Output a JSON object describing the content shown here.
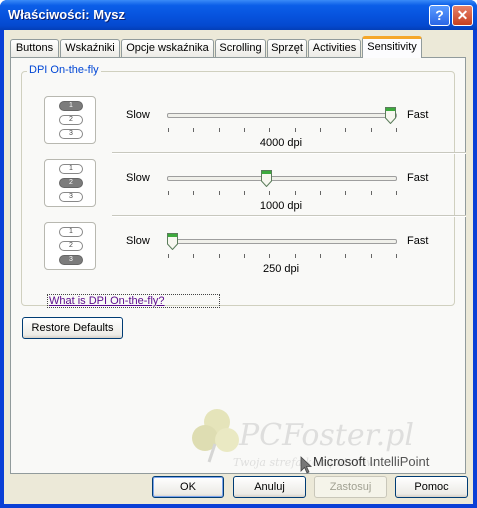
{
  "window": {
    "title": "Właściwości: Mysz"
  },
  "tabs": [
    {
      "label": "Buttons"
    },
    {
      "label": "Wskaźniki"
    },
    {
      "label": "Opcje wskaźnika"
    },
    {
      "label": "Scrolling"
    },
    {
      "label": "Sprzęt"
    },
    {
      "label": "Activities"
    },
    {
      "label": "Sensitivity",
      "active": true
    }
  ],
  "group": {
    "title": "DPI On-the-fly"
  },
  "sliders": [
    {
      "slow": "Slow",
      "fast": "Fast",
      "value_label": "4000 dpi",
      "level": 1.0,
      "active_preset": "1"
    },
    {
      "slow": "Slow",
      "fast": "Fast",
      "value_label": "1000 dpi",
      "level": 0.43,
      "active_preset": "2"
    },
    {
      "slow": "Slow",
      "fast": "Fast",
      "value_label": "250 dpi",
      "level": 0.0,
      "active_preset": "3"
    }
  ],
  "presets": [
    "1",
    "2",
    "3"
  ],
  "link": {
    "text": "What is DPI On-the-fly?"
  },
  "restore_button": {
    "label": "Restore Defaults"
  },
  "brand": {
    "prefix": "Microsoft",
    "name": "IntelliPoint"
  },
  "watermark": {
    "text": "PCFoster.pl",
    "subtext": "Twoja strefa komputerów"
  },
  "footer": {
    "ok": "OK",
    "cancel": "Anuluj",
    "apply": "Zastosuj",
    "help": "Pomoc"
  },
  "colors": {
    "accent": "#0046d5",
    "tab_highlight": "#f5a72a",
    "link": "#5c0b8d",
    "thumb": "#3daa3d"
  }
}
